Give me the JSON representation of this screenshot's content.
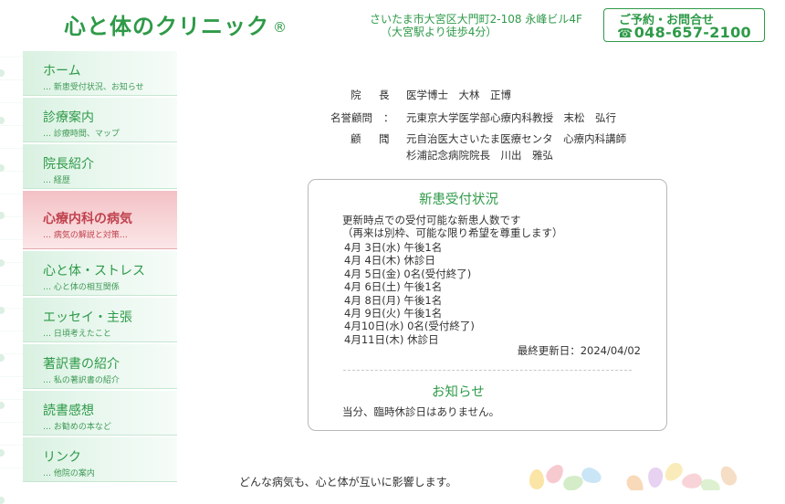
{
  "header": {
    "logo": "心と体のクリニック",
    "logo_mark": "®",
    "address_line1": "さいたま市大宮区大門町2-108 永峰ビル4F",
    "address_line2": "（大宮駅より徒歩4分）",
    "contact_label": "ご予約・お問合せ",
    "phone_icon": "☎",
    "contact_phone": "048-657-2100"
  },
  "sidebar": {
    "items": [
      {
        "title": "ホーム",
        "desc": "… 新患受付状況、お知らせ"
      },
      {
        "title": "診療案内",
        "desc": "… 診療時間、マップ"
      },
      {
        "title": "院長紹介",
        "desc": "… 経歴"
      },
      {
        "title": "心療内科の病気",
        "desc": "… 病気の解説と対策…",
        "active": true
      },
      {
        "title": "心と体・ストレス",
        "desc": "… 心と体の相互関係"
      },
      {
        "title": "エッセイ・主張",
        "desc": "… 日頃考えたこと"
      },
      {
        "title": "著訳書の紹介",
        "desc": "… 私の著訳書の紹介"
      },
      {
        "title": "読書感想",
        "desc": "… お勧めの本など"
      },
      {
        "title": "リンク",
        "desc": "… 他院の案内"
      }
    ]
  },
  "staff": [
    {
      "label": "院　長",
      "value": "医学博士　大林　正博"
    },
    {
      "label": "名誉顧問",
      "value": "元東京大学医学部心療内科教授　末松　弘行"
    },
    {
      "label": "顧　問",
      "value": "元自治医大さいたま医療センタ　心療内科講師"
    },
    {
      "label": "",
      "value": "杉浦記念病院院長　川出　雅弘"
    }
  ],
  "intake": {
    "title": "新患受付状況",
    "intro1": "更新時点での受付可能な新患人数です",
    "intro2": "（再来は別枠、可能な限り希望を尊重します）",
    "days": [
      "4月 3日(水) 午後1名",
      "4月 4日(木) 休診日",
      "4月 5日(金) 0名(受付終了)",
      "4月 6日(土) 午後1名",
      "4月 8日(月) 午後1名",
      "4月 9日(火) 午後1名",
      "4月10日(水) 0名(受付終了)",
      "4月11日(木) 休診日"
    ],
    "updated": "最終更新日：2024/04/02"
  },
  "notice": {
    "title": "お知らせ",
    "text": "当分、臨時休診日はありません。"
  },
  "footer_text": "どんな病気も、心と体が互いに影響します。",
  "colors": {
    "brand_green": "#2e9a48",
    "active_pink": "#f3c1c5",
    "active_text": "#c0434f"
  }
}
